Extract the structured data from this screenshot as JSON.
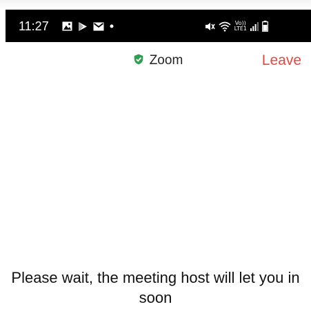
{
  "status_bar": {
    "time": "11:27",
    "left_icons": [
      "gallery-icon",
      "play-store-icon",
      "mail-icon",
      "dot-icon"
    ],
    "right_icons": [
      "mute-icon",
      "wifi-icon",
      "volte-icon",
      "signal-icon",
      "battery-icon"
    ],
    "network_labels": [
      "Vo))",
      "LTE1"
    ]
  },
  "header": {
    "title": "Zoom",
    "title_icon": "shield-check-icon",
    "leave_label": "Leave"
  },
  "main": {
    "wait_message": "Please wait, the meeting host will let you in soon"
  },
  "colors": {
    "status_bar_bg": "#000000",
    "leave": "#e8473f",
    "shield": "#2e9e4f",
    "text": "#111111"
  }
}
